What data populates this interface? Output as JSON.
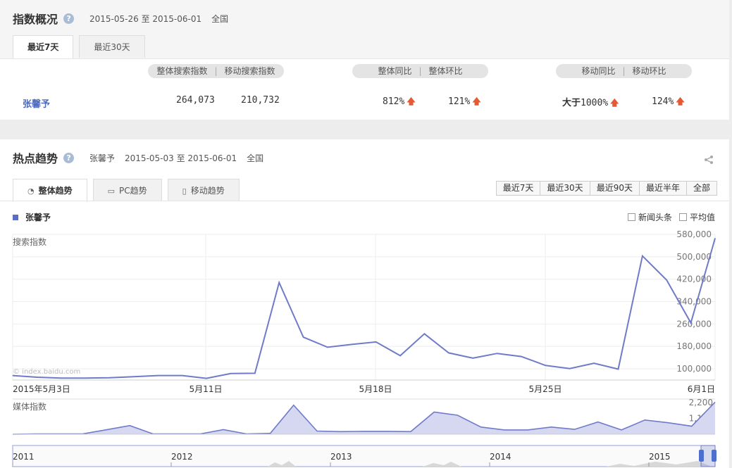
{
  "overview": {
    "title": "指数概况",
    "help": "?",
    "date_range": "2015-05-26 至 2015-06-01",
    "region": "全国",
    "tabs": [
      "最近7天",
      "最近30天"
    ],
    "headers": {
      "search": "整体搜索指数",
      "mobile_search": "移动搜索指数",
      "yoy": "整体同比",
      "mom": "整体环比",
      "mobile_yoy": "移动同比",
      "mobile_mom": "移动环比",
      "sep": "|"
    },
    "keyword": "张馨予",
    "search_index": "264,073",
    "mobile_index": "210,732",
    "yoy_value": "812%",
    "mom_value": "121%",
    "mobile_yoy_prefix": "大于",
    "mobile_yoy_value": "1000%",
    "mobile_mom_value": "124%",
    "arrow": "🡅"
  },
  "trend": {
    "title": "热点趋势",
    "keyword": "张馨予",
    "date_range": "2015-05-03 至 2015-06-01",
    "region": "全国",
    "share_icon": "share-icon",
    "tabs": [
      "整体趋势",
      "PC趋势",
      "移动趋势"
    ],
    "ranges": [
      "最近7天",
      "最近30天",
      "最近90天",
      "最近半年",
      "全部"
    ],
    "legend": "张馨予",
    "checkbox_news": "新闻头条",
    "checkbox_avg": "平均值",
    "accent": "#6f7bc8"
  },
  "chart_data": [
    {
      "type": "line",
      "title": "搜索指数",
      "x": [
        "2015-05-03",
        "2015-05-04",
        "2015-05-05",
        "2015-05-06",
        "2015-05-07",
        "2015-05-08",
        "2015-05-09",
        "2015-05-10",
        "2015-05-11",
        "2015-05-12",
        "2015-05-13",
        "2015-05-14",
        "2015-05-15",
        "2015-05-16",
        "2015-05-17",
        "2015-05-18",
        "2015-05-19",
        "2015-05-20",
        "2015-05-21",
        "2015-05-22",
        "2015-05-23",
        "2015-05-24",
        "2015-05-25",
        "2015-05-26",
        "2015-05-27",
        "2015-05-28",
        "2015-05-29",
        "2015-05-30",
        "2015-06-01"
      ],
      "x_tick_labels": [
        "2015年5月3日",
        "5月11日",
        "5月18日",
        "5月25日",
        "6月1日"
      ],
      "series": [
        {
          "name": "张馨予",
          "values": [
            76000,
            70000,
            67000,
            67000,
            68000,
            72000,
            76000,
            76000,
            66000,
            83000,
            84000,
            408000,
            213000,
            177000,
            187000,
            196000,
            147000,
            225000,
            157000,
            138000,
            155000,
            144000,
            112000,
            101000,
            120000,
            99000,
            503000,
            417000,
            264000,
            566000
          ]
        }
      ],
      "y_tick_labels": [
        "100,000",
        "180,000",
        "260,000",
        "340,000",
        "420,000",
        "500,000",
        "580,000"
      ],
      "ylim": [
        60000,
        580000
      ],
      "watermark": "© index.baidu.com",
      "grid": true
    },
    {
      "type": "area",
      "title": "媒体指数",
      "series": [
        {
          "name": "张馨予",
          "values": [
            0,
            20,
            20,
            30,
            310,
            600,
            20,
            20,
            20,
            320,
            20,
            60,
            2020,
            220,
            180,
            200,
            200,
            180,
            1540,
            1320,
            500,
            300,
            300,
            500,
            340,
            850,
            300,
            990,
            800,
            560,
            2230
          ]
        }
      ],
      "y_tick_labels": [
        "1,100",
        "2,200"
      ],
      "ylim": [
        0,
        2300
      ]
    },
    {
      "type": "area",
      "title": "navigator",
      "x_tick_labels": [
        "2011",
        "2012",
        "2013",
        "2014",
        "2015"
      ]
    }
  ]
}
